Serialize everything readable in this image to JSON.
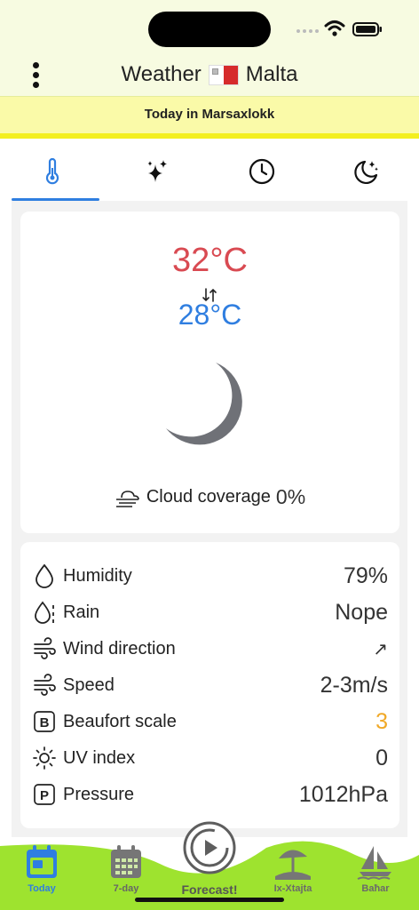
{
  "header": {
    "title_left": "Weather",
    "title_right": "Malta"
  },
  "banner": {
    "text": "Today in Marsaxlokk"
  },
  "tabs": [
    {
      "icon": "thermometer-icon",
      "active": true
    },
    {
      "icon": "sparkles-icon",
      "active": false
    },
    {
      "icon": "clock-icon",
      "active": false
    },
    {
      "icon": "moon-stars-icon",
      "active": false
    }
  ],
  "today": {
    "temp_high": "32°C",
    "temp_low": "28°C",
    "condition_icon": "moon-icon",
    "cloud_label": "Cloud coverage",
    "cloud_value": "0%"
  },
  "details": [
    {
      "icon": "droplet-icon",
      "label": "Humidity",
      "value": "79%"
    },
    {
      "icon": "rain-icon",
      "label": "Rain",
      "value": "Nope"
    },
    {
      "icon": "wind-icon",
      "label": "Wind direction",
      "value": "↗"
    },
    {
      "icon": "wind-icon",
      "label": "Speed",
      "value": "2-3m/s"
    },
    {
      "icon": "beaufort-icon",
      "label": "Beaufort scale",
      "value": "3"
    },
    {
      "icon": "sun-icon",
      "label": "UV index",
      "value": "0"
    },
    {
      "icon": "pressure-icon",
      "label": "Pressure",
      "value": "1012hPa"
    }
  ],
  "nav": {
    "today": "Today",
    "seven_day": "7-day",
    "forecast": "Forecast!",
    "beach": "Ix-Xtajta",
    "sea": "Baħar"
  },
  "colors": {
    "accent_blue": "#2f7ee0",
    "temp_red": "#d94a52",
    "beaufort_orange": "#f0a826",
    "nav_green": "#9ee32f",
    "header_bg": "#f7fbe1",
    "banner_bg": "#fafaa8"
  }
}
